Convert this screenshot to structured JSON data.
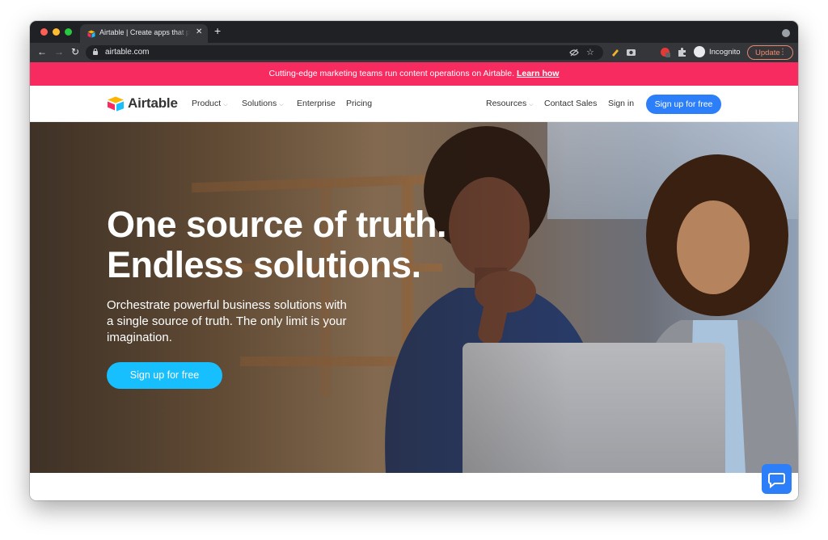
{
  "browser": {
    "tab_title": "Airtable | Create apps that perfectly fit your needs",
    "tab_close": "✕",
    "new_tab": "+",
    "url": "airtable.com",
    "incognito_label": "Incognito",
    "update_label": "Update",
    "back": "←",
    "forward": "→",
    "reload": "↻",
    "omni_icons": [
      "eye-off-icon",
      "star-icon"
    ]
  },
  "banner": {
    "text": "Cutting-edge marketing teams run content operations on Airtable.",
    "link": "Learn how"
  },
  "nav": {
    "logo_text": "Airtable",
    "items": [
      {
        "label": "Product",
        "has_caret": true
      },
      {
        "label": "Solutions",
        "has_caret": true
      },
      {
        "label": "Enterprise",
        "has_caret": false
      },
      {
        "label": "Pricing",
        "has_caret": false
      }
    ],
    "right_items": [
      {
        "label": "Resources",
        "has_caret": true
      },
      {
        "label": "Contact Sales",
        "has_caret": false
      },
      {
        "label": "Sign in",
        "has_caret": false
      }
    ],
    "cta": "Sign up for free"
  },
  "hero": {
    "title_line1": "One source of truth.",
    "title_line2": "Endless solutions.",
    "subtitle": "Orchestrate powerful business solutions with a single source of truth. The only limit is your imagination.",
    "cta": "Sign up for free"
  },
  "colors": {
    "banner": "#f82b60",
    "nav_cta": "#2d7ff9",
    "hero_cta": "#18bfff"
  }
}
